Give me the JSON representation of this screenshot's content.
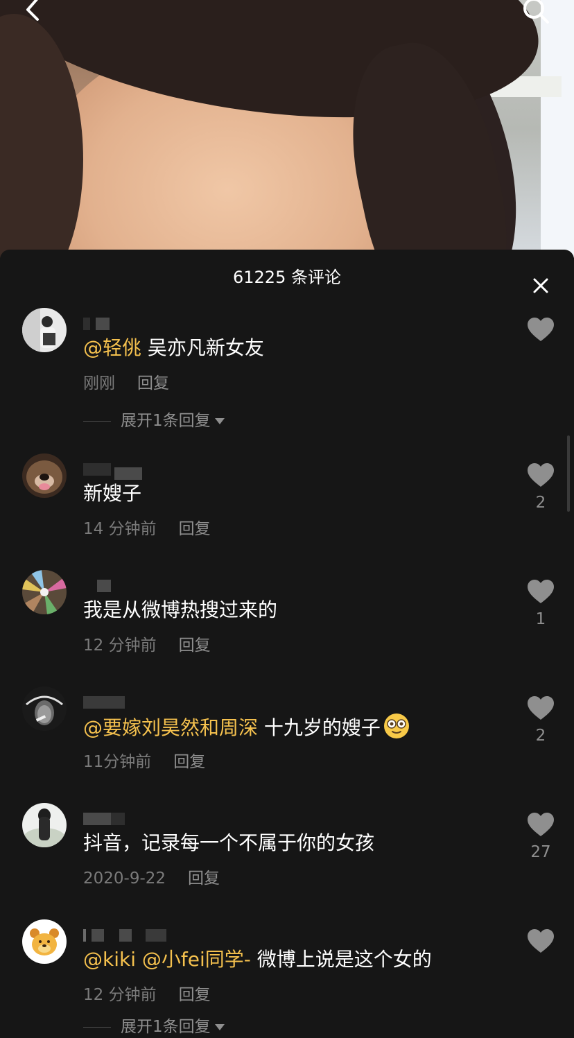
{
  "header": {
    "title": "61225 条评论"
  },
  "colors": {
    "background": "#161616",
    "mention": "#f5c14e",
    "meta_text": "#7b7b7b",
    "like_icon": "#8f8f8f"
  },
  "icons": {
    "back": "chevron-left-icon",
    "search": "search-icon",
    "close": "close-icon",
    "like": "heart-icon"
  },
  "comments": [
    {
      "mention": "@轻佻",
      "text": " 吴亦凡新女友",
      "time": "刚刚",
      "reply_label": "回复",
      "likes": "",
      "expand_label": "展开1条回复"
    },
    {
      "mention": "",
      "text": "新嫂子",
      "time": "14 分钟前",
      "reply_label": "回复",
      "likes": "2"
    },
    {
      "mention": "",
      "text": "我是从微博热搜过来的",
      "time": "12 分钟前",
      "reply_label": "回复",
      "likes": "1"
    },
    {
      "mention": "@要嫁刘昊然和周深",
      "text": " 十九岁的嫂子",
      "time": "11分钟前",
      "reply_label": "回复",
      "likes": "2"
    },
    {
      "mention": "",
      "text": "抖音，记录每一个不属于你的女孩",
      "time": "2020-9-22",
      "reply_label": "回复",
      "likes": "27"
    },
    {
      "mention": "@kiki @小fei同学-",
      "text": " 微博上说是这个女的",
      "time": "12 分钟前",
      "reply_label": "回复",
      "likes": "",
      "expand_label": "展开1条回复"
    }
  ]
}
